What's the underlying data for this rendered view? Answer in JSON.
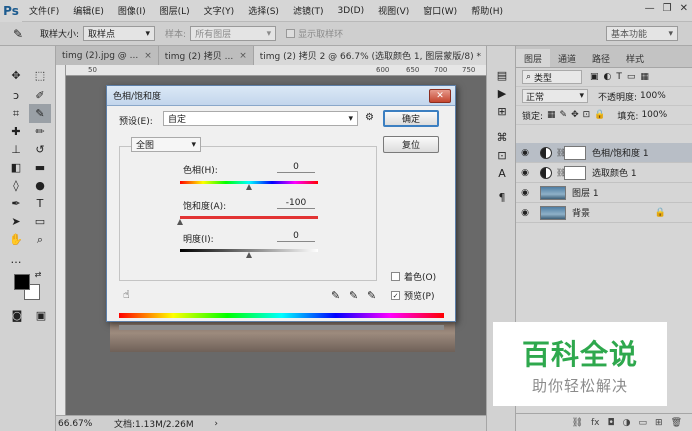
{
  "app": {
    "logo": "Ps"
  },
  "menu": [
    "文件(F)",
    "编辑(E)",
    "图像(I)",
    "图层(L)",
    "文字(Y)",
    "选择(S)",
    "滤镜(T)",
    "3D(D)",
    "视图(V)",
    "窗口(W)",
    "帮助(H)"
  ],
  "window_controls": {
    "minimize": "—",
    "restore": "❐",
    "close": "✕"
  },
  "options": {
    "sample_size_label": "取样大小:",
    "sample_size_value": "取样点",
    "sample_label": "样本:",
    "sample_value": "所有图层",
    "show_ring_label": "显示取样环",
    "workspace": "基本功能"
  },
  "tabs": [
    {
      "label": "timg (2).jpg @ ...",
      "close": "×"
    },
    {
      "label": "timg (2) 拷贝 ...",
      "close": "×"
    },
    {
      "label": "timg (2) 拷贝 2 @ 66.7% (选取颜色 1, 图层蒙版/8) *",
      "close": "×"
    }
  ],
  "ruler": [
    "50",
    "600",
    "650",
    "700",
    "750"
  ],
  "status": {
    "zoom": "66.67%",
    "doc": "文档:1.13M/2.26M"
  },
  "dialog": {
    "title": "色相/饱和度",
    "close": "✕",
    "preset_label": "预设(E):",
    "preset_value": "自定",
    "ok": "确定",
    "reset": "复位",
    "channel": "全图",
    "hue_label": "色相(H):",
    "hue_value": "0",
    "saturation_label": "饱和度(A):",
    "saturation_value": "-100",
    "lightness_label": "明度(I):",
    "lightness_value": "0",
    "colorize_label": "着色(O)",
    "colorize_checked": false,
    "preview_label": "预览(P)",
    "preview_checked": true,
    "preview_mark": "✓"
  },
  "panels": {
    "tabs": [
      "图层",
      "通道",
      "路径",
      "样式"
    ],
    "filter_kind": "类型",
    "blend_mode": "正常",
    "opacity_label": "不透明度:",
    "opacity_value": "100%",
    "lock_label": "锁定:",
    "fill_label": "填充:",
    "fill_value": "100%",
    "layers": [
      {
        "name": "色相/饱和度 1",
        "type": "adjustment",
        "selected": true
      },
      {
        "name": "选取颜色 1",
        "type": "adjustment",
        "selected": false
      },
      {
        "name": "图层 1",
        "type": "pixel",
        "selected": false
      },
      {
        "name": "背景",
        "type": "background",
        "selected": false
      }
    ]
  },
  "watermark": {
    "main": "百科全说",
    "sub": "助你轻松解决"
  },
  "colors": {
    "brand_green": "#2ea84d",
    "ps_blue": "#1c5b8f",
    "dialog_border": "#5d7fa8"
  }
}
